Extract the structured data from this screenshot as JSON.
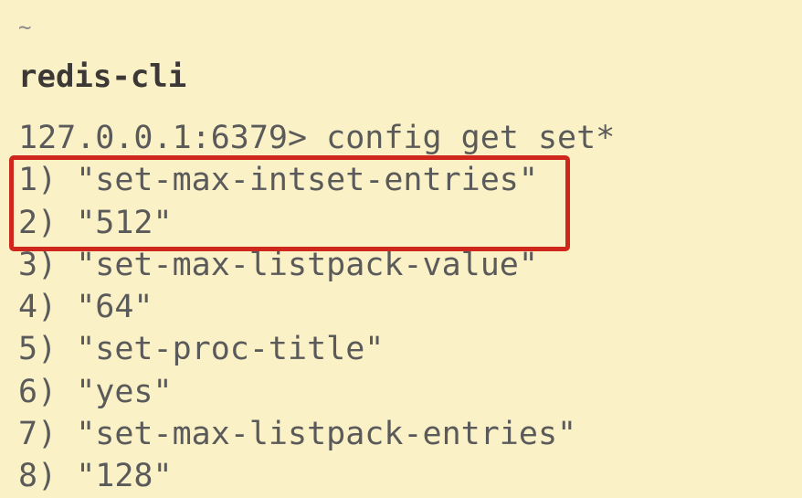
{
  "terminal": {
    "cwd": "~",
    "title": "redis-cli",
    "prompt_line": "127.0.0.1:6379> config get set*",
    "output": [
      "1) \"set-max-intset-entries\"",
      "2) \"512\"",
      "3) \"set-max-listpack-value\"",
      "4) \"64\"",
      "5) \"set-proc-title\"",
      "6) \"yes\"",
      "7) \"set-max-listpack-entries\"",
      "8) \"128\""
    ],
    "highlight_color": "#d0271d",
    "background_color": "#fbf1c7"
  }
}
